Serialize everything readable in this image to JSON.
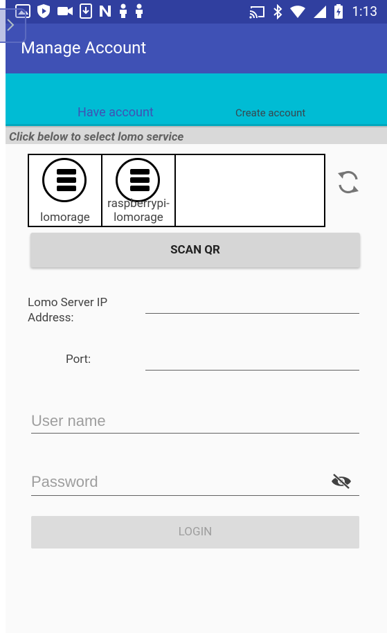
{
  "status_bar": {
    "time": "1:13",
    "icons_left": [
      "gallery-icon",
      "shield-icon",
      "video-icon",
      "download-icon",
      "n-icon",
      "person-icon",
      "person-icon"
    ],
    "icons_right": [
      "cast-icon",
      "bluetooth-icon",
      "wifi-icon",
      "signal-icon",
      "battery-icon"
    ]
  },
  "app_bar": {
    "title": "Manage Account"
  },
  "tabs": [
    {
      "label": "Have account",
      "selected": true
    },
    {
      "label": "Create account",
      "selected": false
    }
  ],
  "hint": "Click below to select lomo service",
  "services": [
    {
      "label": "lomorage",
      "icon": "server-stack-icon"
    },
    {
      "label": "raspberrypi-\nlomorage",
      "icon": "server-stack-icon"
    }
  ],
  "scan_button": "SCAN QR",
  "ip_label": "Lomo Server IP Address:",
  "port_label": "Port:",
  "username_placeholder": "User name",
  "password_placeholder": "Password",
  "login_button": "LOGIN",
  "colors": {
    "status_bar": "#303f9f",
    "app_bar": "#3f51b5",
    "tab_bar": "#00bcd4",
    "selected_tab_text": "#3f51b5"
  }
}
